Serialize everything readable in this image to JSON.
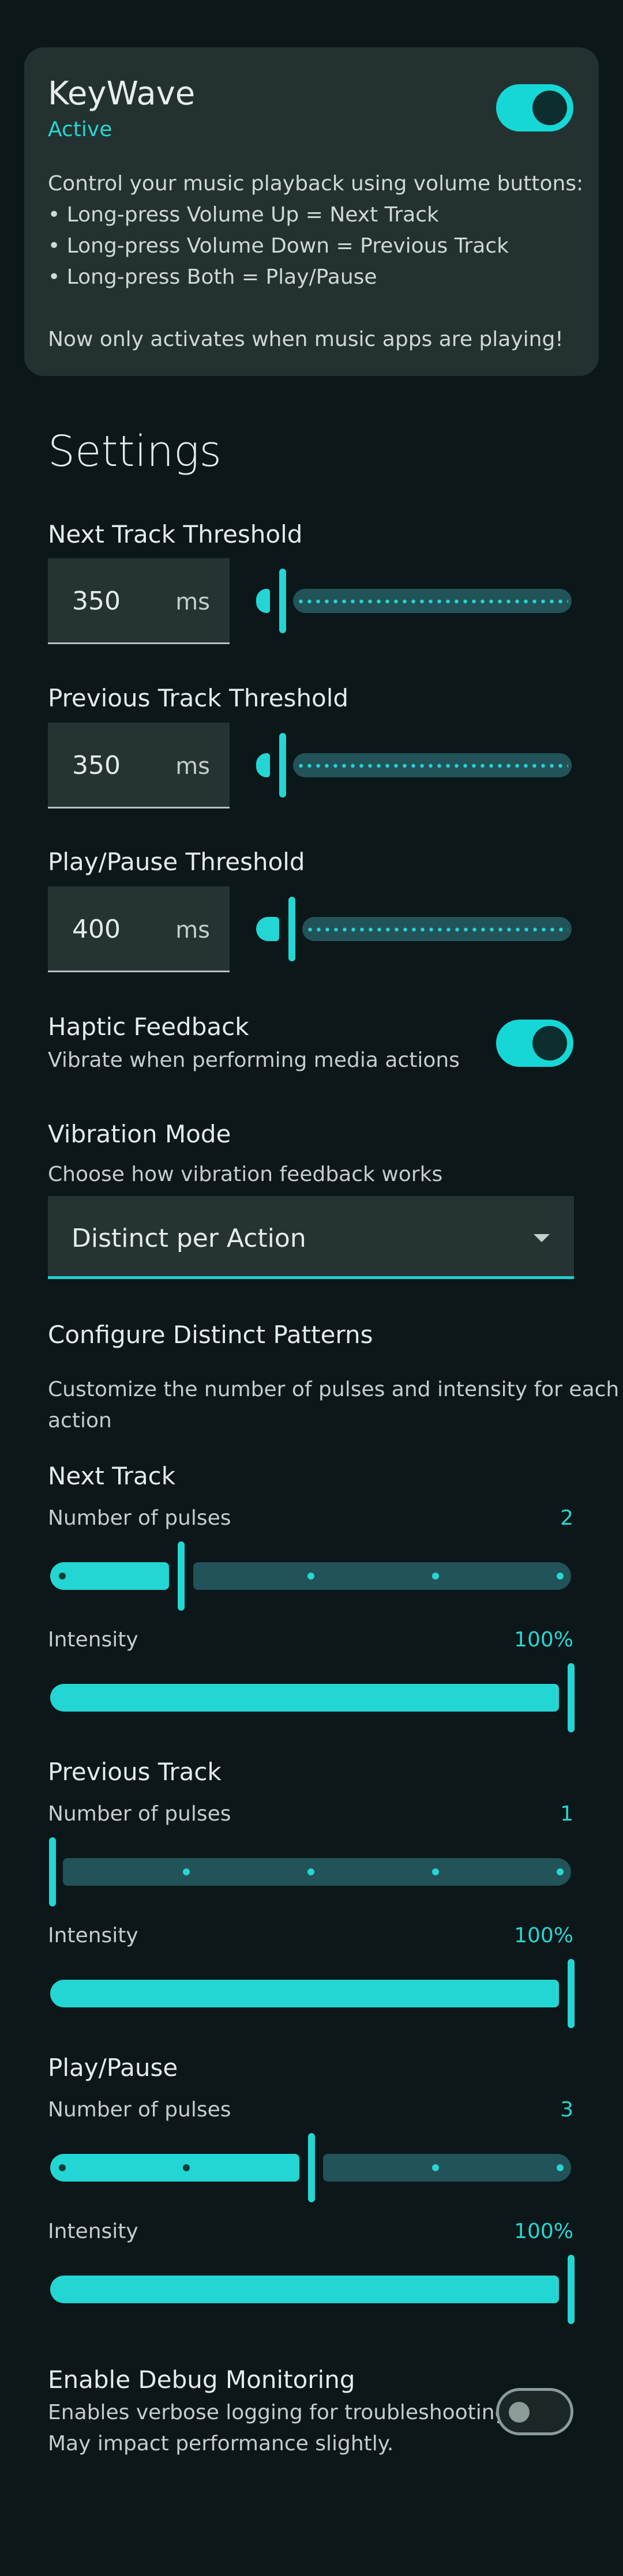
{
  "card": {
    "title": "KeyWave",
    "status": "Active",
    "enabled": true,
    "description": [
      "Control your music playback using volume buttons:",
      "• Long-press Volume Up = Next Track",
      "• Long-press Volume Down = Previous Track",
      "• Long-press Both = Play/Pause",
      "",
      "Now only activates when music apps are playing!"
    ]
  },
  "settings": {
    "heading": "Settings",
    "thresholds": [
      {
        "label": "Next Track Threshold",
        "value": "350",
        "unit": "ms",
        "slider_fraction": 0.07
      },
      {
        "label": "Previous Track Threshold",
        "value": "350",
        "unit": "ms",
        "slider_fraction": 0.07
      },
      {
        "label": "Play/Pause Threshold",
        "value": "400",
        "unit": "ms",
        "slider_fraction": 0.1
      }
    ],
    "haptic": {
      "label": "Haptic Feedback",
      "sub": "Vibrate when performing media actions",
      "enabled": true
    },
    "vibration_mode": {
      "label": "Vibration Mode",
      "sub": "Choose how vibration feedback works",
      "selected": "Distinct per Action"
    },
    "patterns": {
      "heading": "Configure Distinct Patterns",
      "description": [
        "Customize the number of pulses and intensity for each",
        "action"
      ],
      "pulses_label": "Number of pulses",
      "intensity_label": "Intensity",
      "pulse_range": [
        1,
        5
      ],
      "actions": [
        {
          "name": "Next Track",
          "pulses": "2",
          "intensity": "100%",
          "pulses_value": 2,
          "intensity_fraction": 1.0
        },
        {
          "name": "Previous Track",
          "pulses": "1",
          "intensity": "100%",
          "pulses_value": 1,
          "intensity_fraction": 1.0
        },
        {
          "name": "Play/Pause",
          "pulses": "3",
          "intensity": "100%",
          "pulses_value": 3,
          "intensity_fraction": 1.0
        }
      ]
    },
    "debug": {
      "label": "Enable Debug Monitoring",
      "sub": [
        "Enables verbose logging for troubleshooting.",
        "May impact performance slightly."
      ],
      "enabled": false
    }
  },
  "colors": {
    "background": "#0b1718",
    "card": "#243131",
    "accent": "#23d6d4",
    "inactive_track": "#215358"
  }
}
